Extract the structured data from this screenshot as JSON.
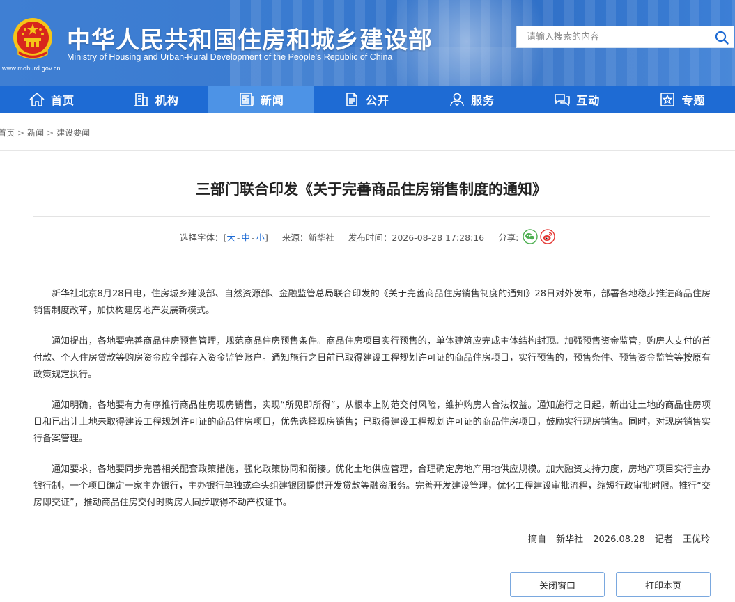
{
  "header": {
    "site_url": "www.mohurd.gov.cn",
    "title_cn": "中华人民共和国住房和城乡建设部",
    "title_en": "Ministry of Housing and Urban-Rural Development of the People’s Republic of China",
    "search_placeholder": "请输入搜索的内容",
    "emblem_icon": "national-emblem",
    "search_icon": "search-icon"
  },
  "nav": {
    "items": [
      {
        "label": "首页",
        "icon": "home-icon"
      },
      {
        "label": "机构",
        "icon": "building-icon"
      },
      {
        "label": "新闻",
        "icon": "newspaper-icon",
        "active": true
      },
      {
        "label": "公开",
        "icon": "document-icon"
      },
      {
        "label": "服务",
        "icon": "user-service-icon"
      },
      {
        "label": "互动",
        "icon": "chat-icon"
      },
      {
        "label": "专题",
        "icon": "star-box-icon"
      }
    ]
  },
  "breadcrumb": [
    "首页",
    "新闻",
    "建设要闻"
  ],
  "article": {
    "title": "三部门联合印发《关于完善商品住房销售制度的通知》",
    "font_label": "选择字体：[",
    "font_large": "大",
    "font_medium": "中",
    "font_small": "小",
    "font_close": "]",
    "source": "来源：新华社",
    "publish_time": "发布时间：2026-08-28 17:28:16",
    "share_label": "分享:",
    "paragraphs": [
      "新华社北京8月28日电，住房城乡建设部、自然资源部、金融监管总局联合印发的《关于完善商品住房销售制度的通知》28日对外发布，部署各地稳步推进商品住房销售制度改革，加快构建房地产发展新模式。",
      "通知提出，各地要完善商品住房预售管理，规范商品住房预售条件。商品住房项目实行预售的，单体建筑应完成主体结构封顶。加强预售资金监管，购房人支付的首付款、个人住房贷款等购房资金应全部存入资金监管账户。通知施行之日前已取得建设工程规划许可证的商品住房项目，实行预售的，预售条件、预售资金监管等按原有政策规定执行。",
      "通知明确，各地要有力有序推行商品住房现房销售，实现“所见即所得”，从根本上防范交付风险，维护购房人合法权益。通知施行之日起，新出让土地的商品住房项目和已出让土地未取得建设工程规划许可证的商品住房项目，优先选择现房销售；已取得建设工程规划许可证的商品住房项目，鼓励实行现房销售。同时，对现房销售实行备案管理。",
      "通知要求，各地要同步完善相关配套政策措施，强化政策协同和衔接。优化土地供应管理，合理确定房地产用地供应规模。加大融资支持力度，房地产项目实行主办银行制，一个项目确定一家主办银行，主办银行单独或牵头组建银团提供开发贷款等融资服务。完善开发建设管理，优化工程建设审批流程，缩短行政审批时限。推行“交房即交证”，推动商品住房交付时购房人同步取得不动产权证书。"
    ],
    "sign_label": "摘自",
    "sign_source": "新华社",
    "sign_date": "2026.08.28",
    "sign_reporter_label": "记者",
    "sign_reporter": "王优玲"
  },
  "buttons": {
    "close": "关闭窗口",
    "print": "打印本页"
  },
  "colors": {
    "nav_bg": "#1e6bd4",
    "nav_active": "#4d93e6",
    "header_bg": "#3a7bd0",
    "button_border": "#7aa8df",
    "wechat": "#4caf50",
    "weibo": "#e53935"
  }
}
